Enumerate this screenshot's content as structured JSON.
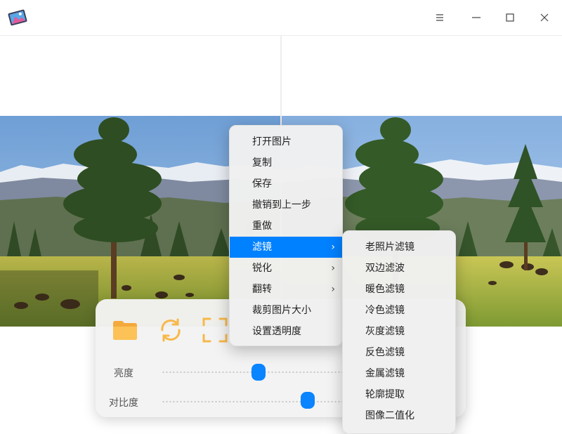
{
  "window": {
    "app_icon": "photo-editor-app-icon",
    "controls": [
      "menu-icon",
      "minimize-icon",
      "maximize-icon",
      "close-icon"
    ]
  },
  "context_menu": {
    "items": [
      {
        "label": "打开图片",
        "submenu": false
      },
      {
        "label": "复制",
        "submenu": false
      },
      {
        "label": "保存",
        "submenu": false
      },
      {
        "label": "撤销到上一步",
        "submenu": false
      },
      {
        "label": "重做",
        "submenu": false
      },
      {
        "label": "滤镜",
        "submenu": true,
        "active": true
      },
      {
        "label": "锐化",
        "submenu": true
      },
      {
        "label": "翻转",
        "submenu": true
      },
      {
        "label": "裁剪图片大小",
        "submenu": false
      },
      {
        "label": "设置透明度",
        "submenu": false
      }
    ],
    "arrow": "›"
  },
  "filter_submenu": {
    "items": [
      "老照片滤镜",
      "双边滤波",
      "暖色滤镜",
      "冷色滤镜",
      "灰度滤镜",
      "反色滤镜",
      "金属滤镜",
      "轮廓提取",
      "图像二值化"
    ]
  },
  "control_panel": {
    "tools": [
      "folder-icon",
      "refresh-icon",
      "fullscreen-icon"
    ],
    "sliders": [
      {
        "label": "亮度",
        "value": 0.33
      },
      {
        "label": "对比度",
        "value": 0.5
      }
    ]
  },
  "colors": {
    "accent": "#0081ff",
    "slider_thumb": "#0a84ff",
    "tool_icon": "#f7b84a"
  }
}
